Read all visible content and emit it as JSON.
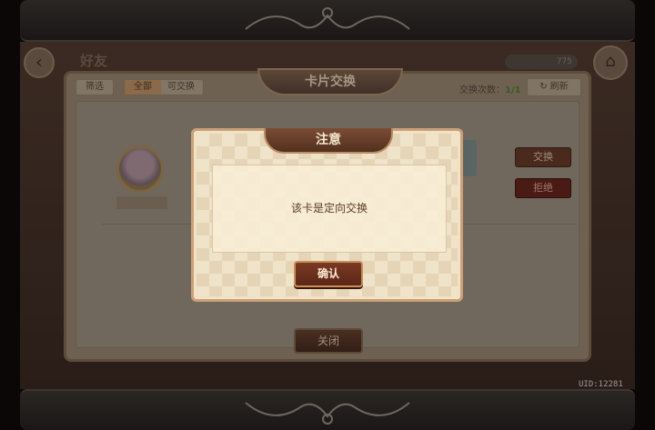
{
  "background": {
    "screen_title": "好友",
    "counter": "775",
    "uid": "UID:12281"
  },
  "panel": {
    "title": "卡片交换",
    "filter_label": "筛选",
    "tabs": [
      "全部",
      "可交换"
    ],
    "exchange_count_label": "交换次数：",
    "exchange_count_value": "1/1",
    "refresh_label": "刷新",
    "swap_label": "交换",
    "reject_label": "拒绝",
    "close_label": "关闭"
  },
  "modal": {
    "title": "注意",
    "message": "该卡是定向交换",
    "confirm_label": "确认"
  }
}
